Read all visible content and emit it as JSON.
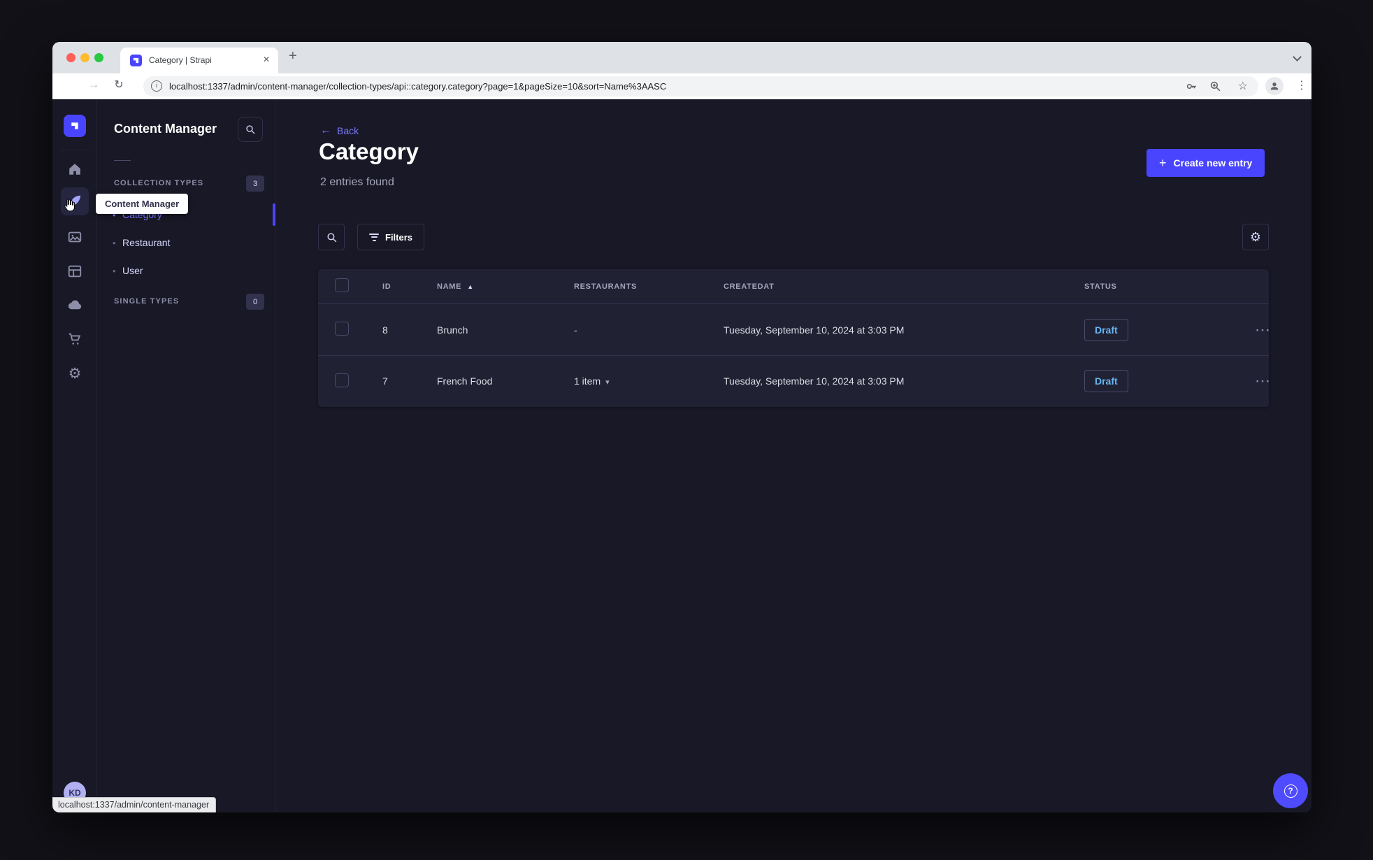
{
  "browser": {
    "tab_title": "Category | Strapi",
    "url": "localhost:1337/admin/content-manager/collection-types/api::category.category?page=1&pageSize=10&sort=Name%3AASC",
    "status_link": "localhost:1337/admin/content-manager"
  },
  "glyphs": {
    "close": "✕",
    "plus": "+",
    "back_arrow": "←",
    "forward_arrow": "→",
    "reload": "↻",
    "menu_dots": "⋮",
    "star": "☆",
    "info": "i",
    "gear": "⚙",
    "sort_asc": "▲",
    "chevron_down": "▾",
    "more": "⋯",
    "bullet": "•",
    "question": "?"
  },
  "colors": {
    "primary": "#4945ff",
    "link": "#7b79ff",
    "draft_text": "#66b7f1",
    "app_bg": "#181826",
    "card_bg": "#212134"
  },
  "sidebar": {
    "tooltip": "Content Manager",
    "avatar_initials": "KD"
  },
  "subnav": {
    "title": "Content Manager",
    "sections": [
      {
        "label": "COLLECTION TYPES",
        "badge": "3",
        "items": [
          {
            "label": "Category"
          },
          {
            "label": "Restaurant"
          },
          {
            "label": "User"
          }
        ]
      },
      {
        "label": "SINGLE TYPES",
        "badge": "0",
        "items": []
      }
    ]
  },
  "main": {
    "back_label": "Back",
    "title": "Category",
    "subtitle": "2 entries found",
    "create_button": "Create new entry",
    "filters_button": "Filters"
  },
  "table": {
    "headers": [
      "ID",
      "NAME",
      "RESTAURANTS",
      "CREATEDAT",
      "STATUS"
    ],
    "sort_column": "NAME",
    "sort_direction": "ASC",
    "rows": [
      {
        "id": "8",
        "name": "Brunch",
        "restaurants": "-",
        "created_at": "Tuesday, September 10, 2024 at 3:03 PM",
        "status": "Draft"
      },
      {
        "id": "7",
        "name": "French Food",
        "restaurants": "1 item",
        "created_at": "Tuesday, September 10, 2024 at 3:03 PM",
        "status": "Draft"
      }
    ]
  }
}
